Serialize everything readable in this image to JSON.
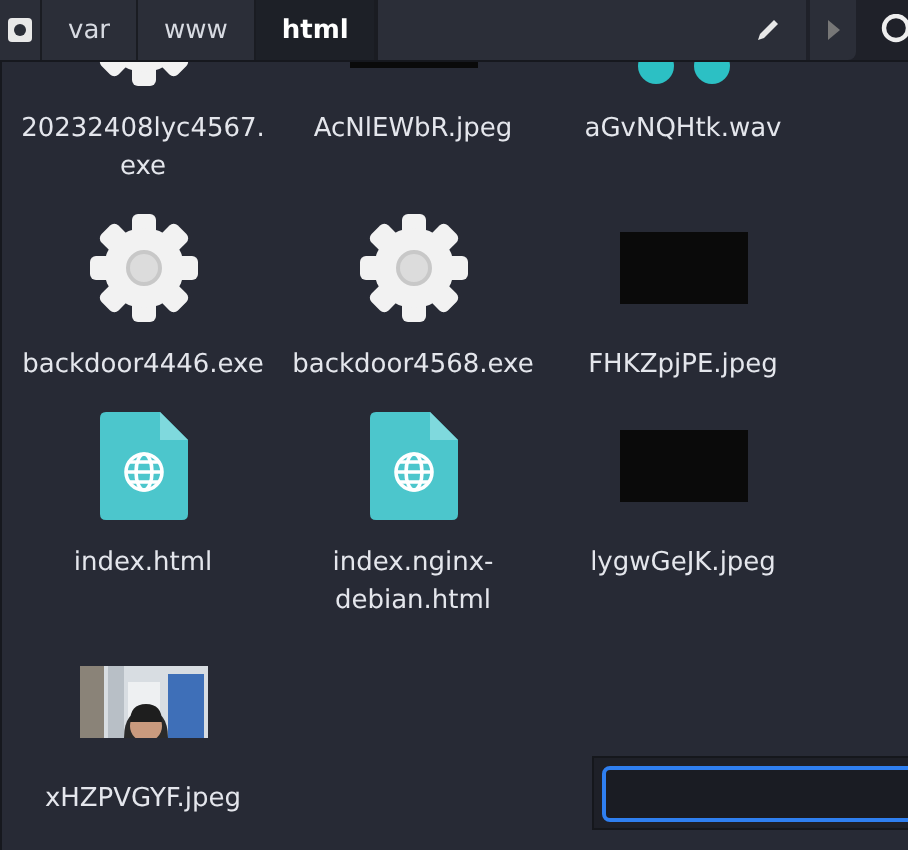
{
  "path_bar": {
    "tabs": [
      {
        "label": "var",
        "selected": false
      },
      {
        "label": "www",
        "selected": false
      },
      {
        "label": "html",
        "selected": true
      }
    ]
  },
  "files": [
    {
      "name": "20232408lyc4567.exe",
      "kind": "executable"
    },
    {
      "name": "AcNlEWbR.jpeg"
    },
    {
      "name": "aGvNQHtk.wav",
      "kind": "audio"
    },
    {
      "name": "backdoor4446.exe",
      "kind": "executable"
    },
    {
      "name": "backdoor4568.exe",
      "kind": "executable"
    },
    {
      "name": "FHKZpjPE.jpeg"
    },
    {
      "name": "index.html",
      "kind": "web"
    },
    {
      "name": "index.nginx-debian.html",
      "kind": "web"
    },
    {
      "name": "lygwGeJK.jpeg"
    },
    {
      "name": "xHZPVGYF.jpeg"
    }
  ]
}
